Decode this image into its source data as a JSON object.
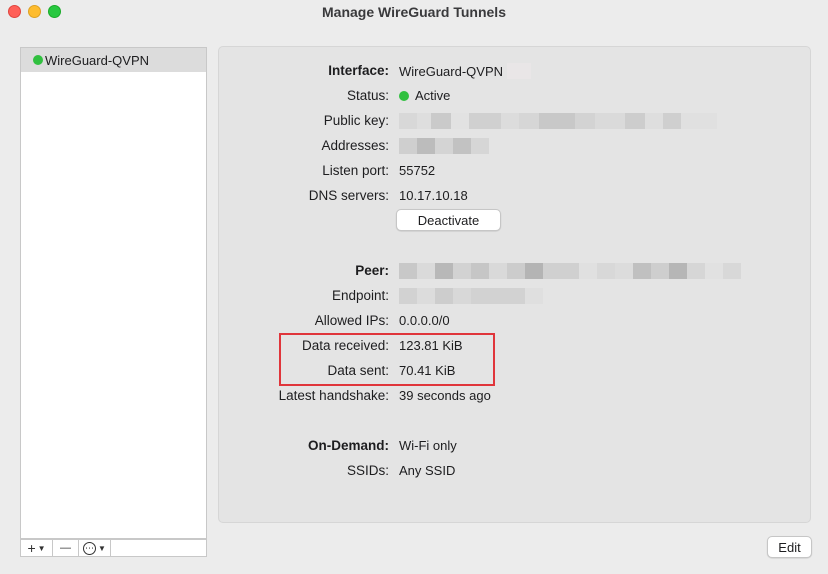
{
  "window": {
    "title": "Manage WireGuard Tunnels"
  },
  "sidebar": {
    "tunnels": [
      {
        "name": "WireGuard-QVPN",
        "status": "active"
      }
    ],
    "toolbar": {
      "add_label": "+",
      "remove_label": "—",
      "more_label": "⋯"
    }
  },
  "details": {
    "interface": {
      "label": "Interface:",
      "value": "WireGuard-QVPN"
    },
    "status": {
      "label": "Status:",
      "value": "Active"
    },
    "public_key": {
      "label": "Public key:"
    },
    "addresses": {
      "label": "Addresses:"
    },
    "listen_port": {
      "label": "Listen port:",
      "value": "55752"
    },
    "dns_servers": {
      "label": "DNS servers:",
      "value": "10.17.10.18"
    },
    "deactivate_label": "Deactivate",
    "peer": {
      "label": "Peer:"
    },
    "endpoint": {
      "label": "Endpoint:"
    },
    "allowed_ips": {
      "label": "Allowed IPs:",
      "value": "0.0.0.0/0"
    },
    "data_received": {
      "label": "Data received:",
      "value": "123.81 KiB"
    },
    "data_sent": {
      "label": "Data sent:",
      "value": "70.41 KiB"
    },
    "latest_handshake": {
      "label": "Latest handshake:",
      "value": "39 seconds ago"
    },
    "on_demand": {
      "label": "On-Demand:",
      "value": "Wi-Fi only"
    },
    "ssids": {
      "label": "SSIDs:",
      "value": "Any SSID"
    }
  },
  "footer": {
    "edit_label": "Edit"
  },
  "colors": {
    "active_green": "#30c03f",
    "highlight_red": "#e0353b"
  }
}
